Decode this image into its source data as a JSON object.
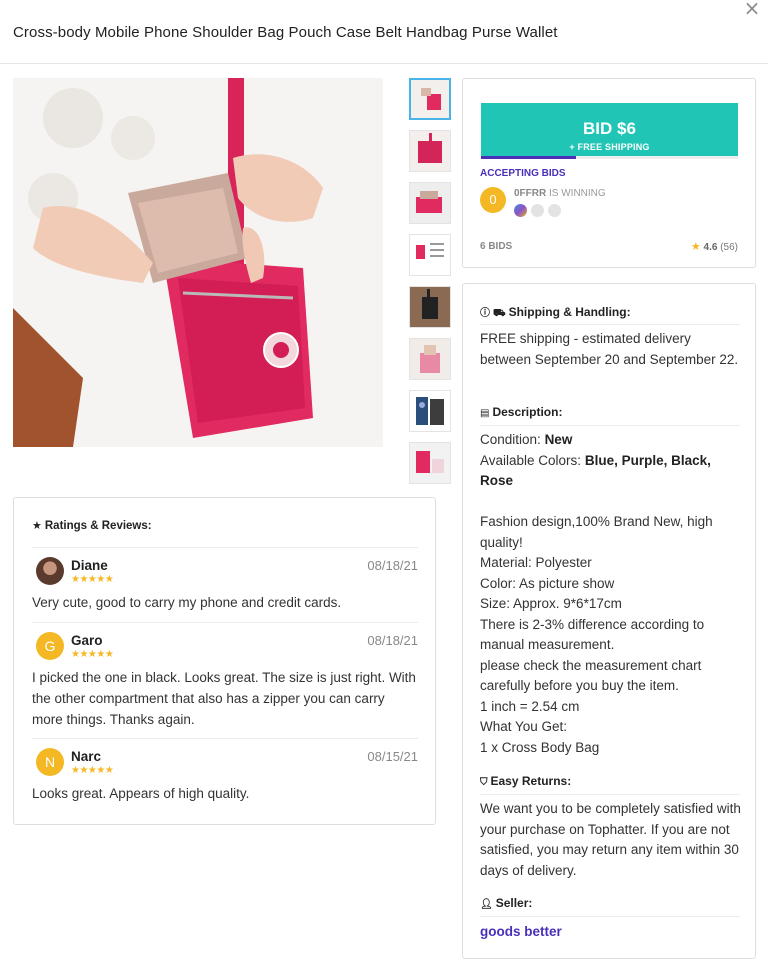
{
  "header": {
    "title": "Cross-body Mobile Phone Shoulder Bag Pouch Case Belt Handbag Purse Wallet",
    "close_glyph": "×"
  },
  "gallery": {
    "thumbnail_count": 8,
    "active_index": 0
  },
  "bid": {
    "button_label": "BID $6",
    "button_sub": "+ FREE SHIPPING",
    "progress_fraction": 0.37,
    "status": "ACCEPTING BIDS",
    "winner_initial": "0",
    "winner_name": "0FFRR",
    "winner_suffix": " IS WINNING",
    "bids_count": "6 BIDS",
    "rating_value": "4.6",
    "rating_count": "(56)"
  },
  "info": {
    "shipping": {
      "heading": "Shipping & Handling:",
      "text": "FREE shipping - estimated delivery between September 20 and September 22."
    },
    "description": {
      "heading": "Description:",
      "condition_label": "Condition:",
      "condition_value": "New",
      "colors_label": "Available Colors:",
      "colors_value": "Blue, Purple, Black, Rose",
      "lines": [
        "Fashion design,100% Brand New, high quality!",
        "Material: Polyester",
        "Color: As picture show",
        "Size: Approx. 9*6*17cm",
        "There is 2-3% difference according to manual measurement.",
        "please check the measurement chart carefully before you buy the item.",
        "1 inch = 2.54 cm",
        "What You Get:",
        "1 x Cross Body Bag"
      ]
    },
    "returns": {
      "heading": "Easy Returns:",
      "text": "We want you to be completely satisfied with your purchase on Tophatter. If you are not satisfied, you may return any item within 30 days of delivery."
    },
    "seller": {
      "heading": "Seller:",
      "name": "goods better"
    }
  },
  "reviews": {
    "heading": "Ratings & Reviews:",
    "items": [
      {
        "name": "Diane",
        "initial": "",
        "stars": "★★★★★",
        "date": "08/18/21",
        "text": "Very cute, good to carry my phone and credit cards."
      },
      {
        "name": "Garo",
        "initial": "G",
        "stars": "★★★★★",
        "date": "08/18/21",
        "text": "I picked the one in black. Looks great. The size is just right. With the other compartment that also has a zipper you can carry more things. Thanks again."
      },
      {
        "name": "Narc",
        "initial": "N",
        "stars": "★★★★★",
        "date": "08/15/21",
        "text": "Looks great. Appears of high quality."
      }
    ]
  },
  "colors": {
    "bid_button": "#20c5b6",
    "accent_purple": "#4b2fb8",
    "star_gold": "#f5b825",
    "product_pink": "#e42a63"
  }
}
